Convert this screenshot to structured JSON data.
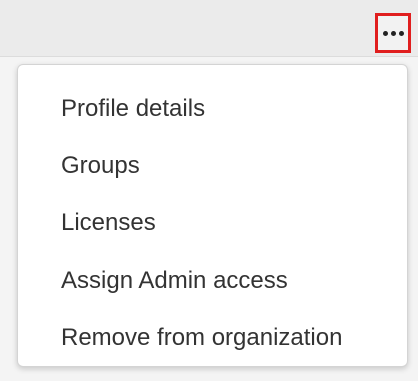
{
  "toolbar": {
    "more_icon": "more-horizontal-icon",
    "highlight_color": "#e01e1e"
  },
  "menu": {
    "items": [
      {
        "label": "Profile details"
      },
      {
        "label": "Groups"
      },
      {
        "label": "Licenses"
      },
      {
        "label": "Assign Admin access"
      },
      {
        "label": "Remove from organization"
      }
    ]
  }
}
